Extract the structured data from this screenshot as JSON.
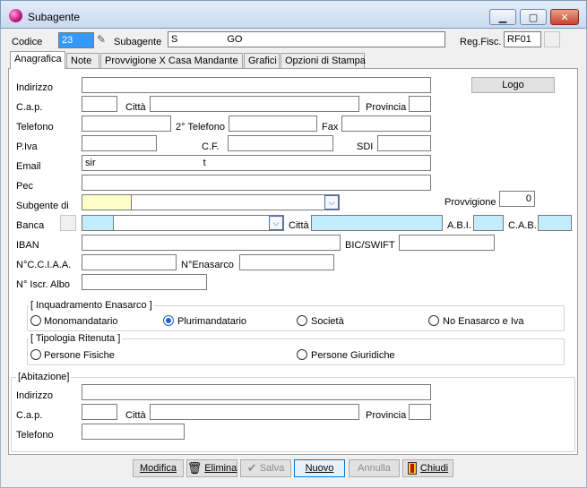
{
  "window": {
    "title": "Subagente",
    "minimize": "▁",
    "maximize": "▢",
    "close": "✕"
  },
  "header": {
    "codice_label": "Codice",
    "codice_value": "23",
    "subagente_label": "Subagente",
    "subagente_value_start": "S",
    "subagente_value_end": "GO",
    "regfisc_label": "Reg.Fisc.",
    "regfisc_value": "RF01"
  },
  "tabs": [
    "Anagrafica",
    "Note",
    "Provvigione X Casa Mandante",
    "Grafici",
    "Opzioni di Stampa"
  ],
  "form": {
    "indirizzo": "Indirizzo",
    "logo_button": "Logo",
    "cap": "C.a.p.",
    "citta": "Città",
    "provincia": "Provincia",
    "telefono": "Telefono",
    "telefono2": "2° Telefono",
    "fax": "Fax",
    "piva": "P.Iva",
    "cf": "C.F.",
    "sdi": "SDI",
    "email": "Email",
    "email_value_start": "sir",
    "email_value_end": "t",
    "pec": "Pec",
    "subgente_di": "Subgente di",
    "provvigione": "Provvigione",
    "provvigione_value": "0",
    "banca": "Banca",
    "citta_banca": "Città",
    "abi": "A.B.I.",
    "cab": "C.A.B.",
    "iban": "IBAN",
    "bic": "BIC/SWIFT",
    "cciaa": "N°C.C.I.A.A.",
    "enasarco": "N°Enasarco",
    "iscr_albo": "N° Iscr. Albo"
  },
  "inquadramento": {
    "title": "[ Inquadramento Enasarco ]",
    "options": [
      "Monomandatario",
      "Plurimandatario",
      "Società",
      "No Enasarco e Iva"
    ],
    "selected": "Plurimandatario"
  },
  "ritenuta": {
    "title": "[ Tipologia Ritenuta ]",
    "options": [
      "Persone Fisiche",
      "Persone Giuridiche"
    ]
  },
  "abitazione": {
    "title": "[Abitazione]",
    "indirizzo": "Indirizzo",
    "cap": "C.a.p.",
    "citta": "Città",
    "provincia": "Provincia",
    "telefono": "Telefono"
  },
  "toolbar": {
    "modifica": "Modifica",
    "elimina": "Elimina",
    "salva": "Salva",
    "nuovo": "Nuovo",
    "annulla": "Annulla",
    "chiudi": "Chiudi"
  }
}
